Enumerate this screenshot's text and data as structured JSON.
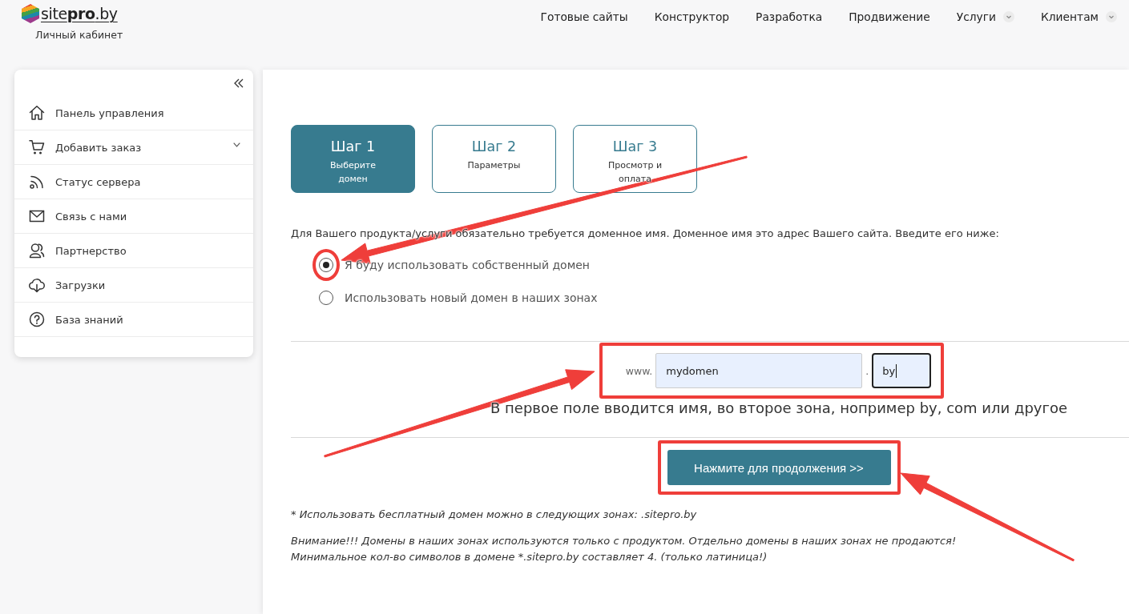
{
  "header": {
    "logo": {
      "text": "site**pro**.by",
      "caption": "Личный кабинет"
    },
    "nav": [
      {
        "label": "Готовые сайты",
        "has_menu": false
      },
      {
        "label": "Конструктор",
        "has_menu": false
      },
      {
        "label": "Разработка",
        "has_menu": false
      },
      {
        "label": "Продвижение",
        "has_menu": false
      },
      {
        "label": "Услуги",
        "has_menu": true
      },
      {
        "label": "Клиентам",
        "has_menu": true
      }
    ]
  },
  "sidebar": {
    "items": [
      {
        "label": "Панель управления",
        "expandable": false
      },
      {
        "label": "Добавить заказ",
        "expandable": true
      },
      {
        "label": "Статус сервера",
        "expandable": false
      },
      {
        "label": "Связь с нами",
        "expandable": false
      },
      {
        "label": "Партнерство",
        "expandable": false
      },
      {
        "label": "Загрузки",
        "expandable": false
      },
      {
        "label": "База знаний",
        "expandable": false
      }
    ]
  },
  "steps": [
    {
      "title": "Шаг 1",
      "subtitle": "Выберите домен",
      "selected": true
    },
    {
      "title": "Шаг 2",
      "subtitle": "Параметры",
      "selected": false
    },
    {
      "title": "Шаг 3",
      "subtitle": "Просмотр и оплата",
      "selected": false
    }
  ],
  "intro": "Для Вашего продукта/услуги обязательно требуется доменное имя. Доменное имя это адрес Вашего сайта. Введите его ниже:",
  "options": [
    {
      "label": "Я буду использовать собственный домен",
      "selected": true,
      "highlighted": true
    },
    {
      "label": "Использовать новый домен в наших зонах",
      "selected": false,
      "highlighted": false
    }
  ],
  "domain": {
    "prefix": "www.",
    "name_field": {
      "value": "mydomen",
      "autofilled": true,
      "focused": false
    },
    "separator": ".",
    "zone_field": {
      "value": "by",
      "autofilled": true,
      "focused": true
    },
    "highlighted": true
  },
  "hint": "В первое поле вводится имя, во второе зона, нопример by, com или другое",
  "continue_button": {
    "label": "Нажмите для продолжения >>",
    "highlighted": true
  },
  "footnote": "* Использовать бесплатный домен можно в следующих зонах: .sitepro.by",
  "warning_lines": [
    "Внимание!!! Домены в наших зонах используются только с продуктом. Отдельно домены в наших зонах не продаются!",
    "Минимальное кол-во символов в домене *.sitepro.by составляет 4. (только латиница!)"
  ],
  "annotations": [
    {
      "kind": "arrow"
    },
    {
      "kind": "arrow"
    },
    {
      "kind": "arrow"
    }
  ]
}
